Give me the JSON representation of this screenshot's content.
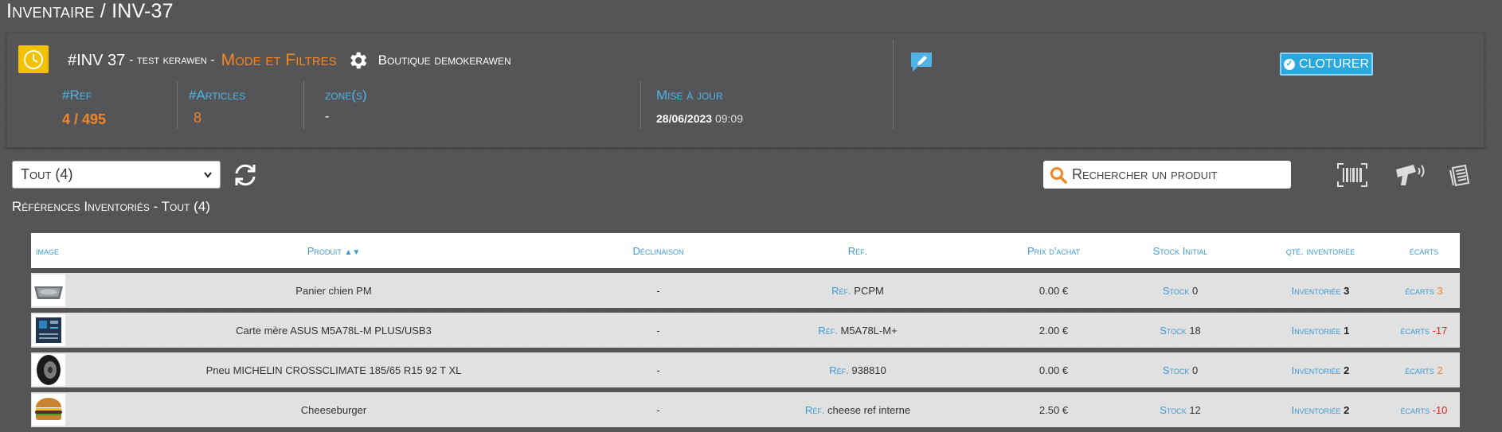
{
  "page_title": "Inventaire / INV-37",
  "header": {
    "inv_number": "#INV 37",
    "inv_name": "- test kerawen -",
    "mode_link": "Mode et Filtres",
    "shop_name": "Boutique demokerawen",
    "close_label": "CLOTURER",
    "stats": {
      "ref_label": "#Ref",
      "ref_value": "4 / 495",
      "articles_label": "#Articles",
      "articles_value": "8",
      "zones_label": "zone(s)",
      "zones_value": "-",
      "update_label": "Mise à jour",
      "update_date": "28/06/2023",
      "update_time": "09:09"
    }
  },
  "toolbar": {
    "filter_value": "Tout (4)",
    "search_placeholder": "Rechercher un produit"
  },
  "section_title": "Références Inventoriés - Tout (4)",
  "table": {
    "headers": {
      "image": "image",
      "product": "Produit",
      "declinaison": "Déclinaison",
      "ref": "Réf.",
      "price": "Prix d'achat",
      "stock": "Stock Initial",
      "qty": "qté. inventoriée",
      "ecarts": "écarts"
    },
    "row_labels": {
      "ref": "Réf.",
      "stock": "Stock",
      "qty": "Inventoriée",
      "ecarts": "écarts"
    },
    "rows": [
      {
        "product": "Panier chien PM",
        "declinaison": "-",
        "ref": "PCPM",
        "price": "0.00 €",
        "stock": "0",
        "qty": "3",
        "ecart": "3",
        "ecart_sign": "pos",
        "thumb": "basket"
      },
      {
        "product": "Carte mère ASUS M5A78L-M PLUS/USB3",
        "declinaison": "-",
        "ref": "M5A78L-M+",
        "price": "2.00 €",
        "stock": "18",
        "qty": "1",
        "ecart": "-17",
        "ecart_sign": "neg",
        "thumb": "board"
      },
      {
        "product": "Pneu MICHELIN CROSSCLIMATE 185/65 R15 92 T XL",
        "declinaison": "-",
        "ref": "938810",
        "price": "0.00 €",
        "stock": "0",
        "qty": "2",
        "ecart": "2",
        "ecart_sign": "pos",
        "thumb": "tire"
      },
      {
        "product": "Cheeseburger",
        "declinaison": "-",
        "ref": "cheese ref interne",
        "price": "2.50 €",
        "stock": "12",
        "qty": "2",
        "ecart": "-10",
        "ecart_sign": "neg",
        "thumb": "burger"
      }
    ]
  },
  "colors": {
    "accent_orange": "#f0862a",
    "accent_blue": "#3d9ad1",
    "close_button": "#29a9e0",
    "clock_badge": "#f2c200",
    "negative": "#e62020"
  },
  "icons": [
    "clock-icon",
    "gear-icon",
    "comment-edit-icon",
    "check-circle-icon",
    "refresh-icon",
    "search-icon",
    "barcode-icon",
    "scanner-icon",
    "list-icon",
    "sort-icon"
  ]
}
